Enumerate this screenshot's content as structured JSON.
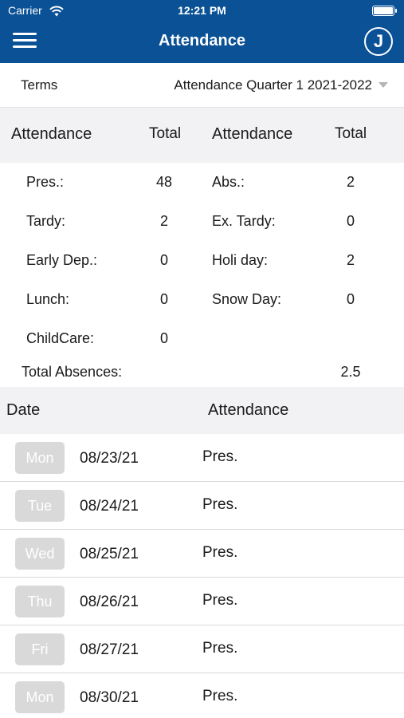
{
  "status_bar": {
    "carrier": "Carrier",
    "time": "12:21 PM"
  },
  "header": {
    "title": "Attendance",
    "avatar_initial": "J",
    "accent_color": "#0b5196"
  },
  "terms": {
    "label": "Terms",
    "selected": "Attendance Quarter 1 2021-2022"
  },
  "summary": {
    "header": {
      "left_col": "Attendance",
      "left_total": "Total",
      "right_col": "Attendance",
      "right_total": "Total"
    },
    "rows": [
      {
        "left_label": "Pres.:",
        "left_value": "48",
        "right_label": "Abs.:",
        "right_value": "2"
      },
      {
        "left_label": "Tardy:",
        "left_value": "2",
        "right_label": "Ex. Tardy:",
        "right_value": "0"
      },
      {
        "left_label": "Early Dep.:",
        "left_value": "0",
        "right_label": "Holi day:",
        "right_value": "2"
      },
      {
        "left_label": "Lunch:",
        "left_value": "0",
        "right_label": "Snow Day:",
        "right_value": "0"
      },
      {
        "left_label": "ChildCare:",
        "left_value": "0",
        "right_label": "",
        "right_value": ""
      }
    ],
    "total_absences_label": "Total Absences:",
    "total_absences_value": "2.5"
  },
  "list": {
    "header": {
      "date": "Date",
      "attendance": "Attendance"
    },
    "rows": [
      {
        "day": "Mon",
        "date": "08/23/21",
        "status": "Pres."
      },
      {
        "day": "Tue",
        "date": "08/24/21",
        "status": "Pres."
      },
      {
        "day": "Wed",
        "date": "08/25/21",
        "status": "Pres."
      },
      {
        "day": "Thu",
        "date": "08/26/21",
        "status": "Pres."
      },
      {
        "day": "Fri",
        "date": "08/27/21",
        "status": "Pres."
      },
      {
        "day": "Mon",
        "date": "08/30/21",
        "status": "Pres."
      }
    ]
  }
}
